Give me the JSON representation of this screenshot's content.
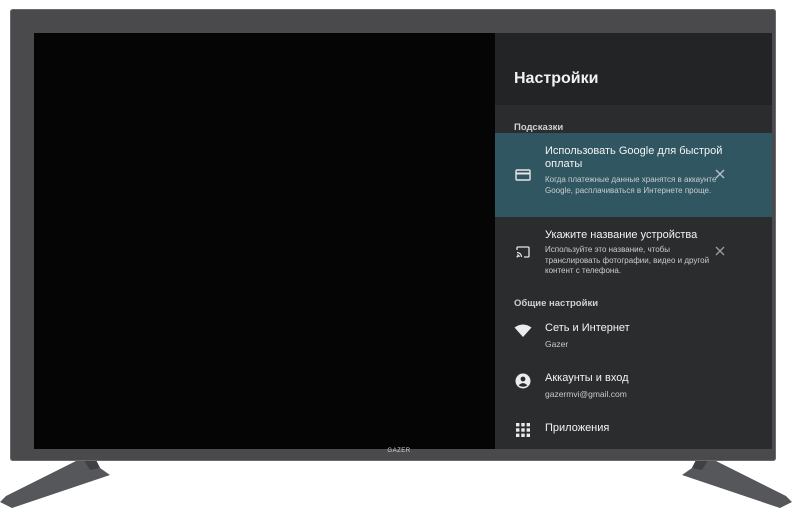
{
  "brand": {
    "logo_text": "GAZER"
  },
  "settings": {
    "title": "Настройки",
    "suggestions_label": "Подсказки",
    "suggestions": [
      {
        "title": "Использовать Google для быстрой оплаты",
        "description": "Когда платежные данные хранятся в аккаунте Google, расплачиваться в Интернете проще.",
        "icon": "credit-card-icon"
      },
      {
        "title": "Укажите название устройства",
        "description": "Используйте это название, чтобы транслировать фотографии, видео и другой контент с телефона.",
        "icon": "cast-icon"
      }
    ],
    "general_label": "Общие настройки",
    "general": [
      {
        "title": "Сеть и Интернет",
        "subtitle": "Gazer",
        "icon": "wifi-icon"
      },
      {
        "title": "Аккаунты и вход",
        "subtitle": "gazermvi@gmail.com",
        "icon": "account-icon"
      },
      {
        "title": "Приложения",
        "icon": "apps-grid-icon"
      }
    ]
  },
  "colors": {
    "panel_bg": "#2b2c2e",
    "highlight": "#2f5661",
    "screen_bg": "#050505",
    "frame": "#4a4a4d"
  }
}
